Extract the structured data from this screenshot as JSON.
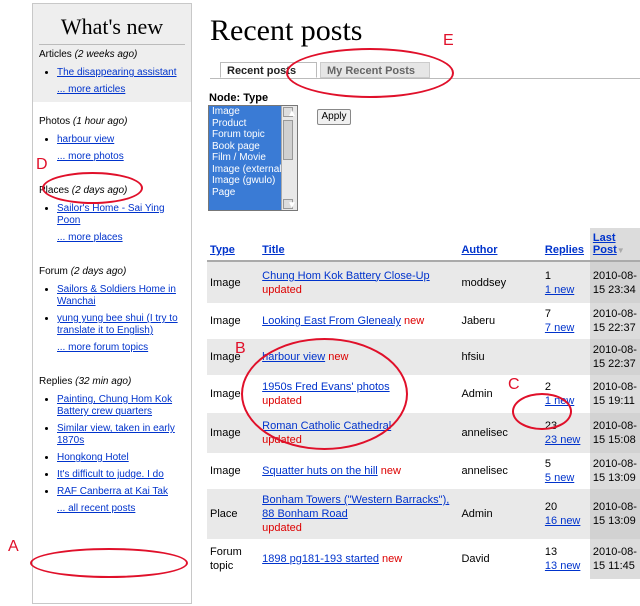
{
  "sidebar": {
    "title": "What's new",
    "articles": {
      "label": "Articles",
      "age": "(2 weeks ago)",
      "items": [
        "The disappearing assistant"
      ],
      "more": "... more articles"
    },
    "photos": {
      "label": "Photos",
      "age": "(1 hour ago)",
      "items": [
        "harbour view"
      ],
      "more": "... more photos"
    },
    "places": {
      "label": "Places",
      "age": "(2 days ago)",
      "items": [
        "Sailor's Home - Sai Ying Poon"
      ],
      "more": "... more places"
    },
    "forum": {
      "label": "Forum",
      "age": "(2 days ago)",
      "items": [
        "Sailors & Soldiers Home in Wanchai",
        "yung yung bee shui (I try to translate it to English)"
      ],
      "more": "... more forum topics"
    },
    "replies": {
      "label": "Replies",
      "age": "(32 min ago)",
      "items": [
        "Painting, Chung Hom Kok Battery crew quarters",
        "Similar view, taken in early 1870s",
        "Hongkong Hotel",
        "It's difficult to judge. I do",
        "RAF Canberra at Kai Tak"
      ],
      "more": "... all recent posts"
    }
  },
  "main": {
    "title": "Recent posts",
    "tabs": [
      "Recent posts",
      "My Recent Posts"
    ],
    "filter_label": "Node: Type",
    "filter_options": [
      "Image",
      "Product",
      "Forum topic",
      "Book page",
      "Film / Movie",
      "Image (external)",
      "Image (gwulo)",
      "Page"
    ],
    "apply_label": "Apply"
  },
  "table": {
    "headers": {
      "type": "Type",
      "title": "Title",
      "author": "Author",
      "replies": "Replies",
      "last": "Last Post"
    },
    "rows": [
      {
        "type": "Image",
        "title": "Chung Hom Kok Battery Close-Up",
        "flag": "updated",
        "author": "moddsey",
        "replies": "1",
        "new": "1 new",
        "date": "2010-08-15 23:34"
      },
      {
        "type": "Image",
        "title": "Looking East From Glenealy",
        "flag": "new",
        "author": "Jaberu",
        "replies": "7",
        "new": "7 new",
        "date": "2010-08-15 22:37"
      },
      {
        "type": "Image",
        "title": "harbour view",
        "flag": "new",
        "author": "hfsiu",
        "replies": "",
        "new": "",
        "date": "2010-08-15 22:37"
      },
      {
        "type": "Image",
        "title": "1950s Fred Evans' photos",
        "flag": "updated",
        "author": "Admin",
        "replies": "2",
        "new": "1 new",
        "date": "2010-08-15 19:11"
      },
      {
        "type": "Image",
        "title": "Roman Catholic Cathedral",
        "flag": "updated",
        "author": "annelisec",
        "replies": "23",
        "new": "23 new",
        "date": "2010-08-15 15:08"
      },
      {
        "type": "Image",
        "title": "Squatter huts on the hill",
        "flag": "new",
        "author": "annelisec",
        "replies": "5",
        "new": "5 new",
        "date": "2010-08-15 13:09"
      },
      {
        "type": "Place",
        "title": "Bonham Towers (\"Western Barracks\"), 88 Bonham Road",
        "flag": "updated",
        "author": "Admin",
        "replies": "20",
        "new": "16 new",
        "date": "2010-08-15 13:09"
      },
      {
        "type": "Forum topic",
        "title": "1898 pg181-193 started",
        "flag": "new",
        "author": "David",
        "replies": "13",
        "new": "13 new",
        "date": "2010-08-15 11:45"
      }
    ]
  },
  "annotations": [
    "A",
    "B",
    "C",
    "D",
    "E"
  ],
  "colors": {
    "annotation": "#e0102a",
    "link": "#0033cc",
    "flag": "#dd0000"
  }
}
